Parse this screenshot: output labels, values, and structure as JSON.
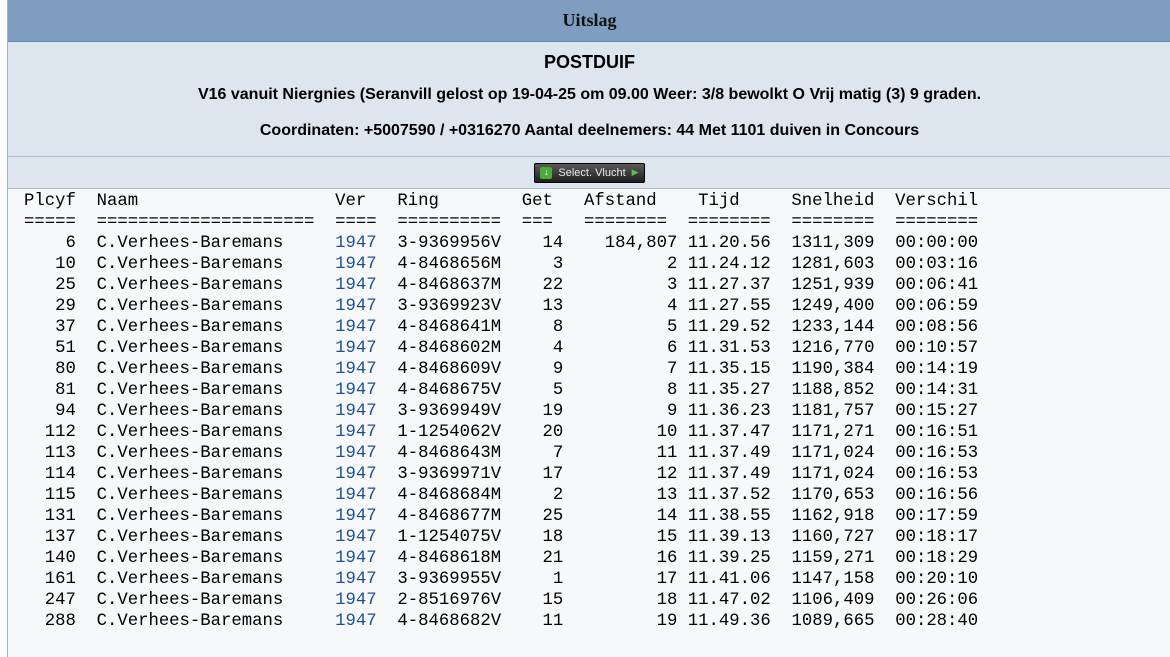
{
  "title": "Uitslag",
  "header": {
    "race": "POSTDUIF",
    "release": "V16 vanuit Niergnies (Seranvill gelost op 19-04-25 om 09.00 Weer: 3/8 bewolkt O Vrij matig (3) 9 graden.",
    "info": "Coordinaten: +5007590 / +0316270 Aantal deelnemers: 44 Met 1101 duiven in Concours"
  },
  "button": {
    "label": "Select. Vlucht",
    "icon": "download-icon",
    "arrow_icon": "arrow-right-icon"
  },
  "table": {
    "header_line": "Plcyf  Naam                   Ver   Ring        Get   Afstand    Tijd     Snelheid  Verschil",
    "separator_line": "=====  =====================  ====  ==========  ===   ========  ========  ========  ========",
    "rows": [
      {
        "plcyf": "6",
        "naam": "C.Verhees-Baremans",
        "ver": "1947",
        "ring": "3-9369956V",
        "get": "14",
        "afstand": "184,807",
        "tijd": "11.20.56",
        "snelheid": "1311,309",
        "verschil": "00:00:00"
      },
      {
        "plcyf": "10",
        "naam": "C.Verhees-Baremans",
        "ver": "1947",
        "ring": "4-8468656M",
        "get": "3",
        "afstand": "2",
        "tijd": "11.24.12",
        "snelheid": "1281,603",
        "verschil": "00:03:16"
      },
      {
        "plcyf": "25",
        "naam": "C.Verhees-Baremans",
        "ver": "1947",
        "ring": "4-8468637M",
        "get": "22",
        "afstand": "3",
        "tijd": "11.27.37",
        "snelheid": "1251,939",
        "verschil": "00:06:41"
      },
      {
        "plcyf": "29",
        "naam": "C.Verhees-Baremans",
        "ver": "1947",
        "ring": "3-9369923V",
        "get": "13",
        "afstand": "4",
        "tijd": "11.27.55",
        "snelheid": "1249,400",
        "verschil": "00:06:59"
      },
      {
        "plcyf": "37",
        "naam": "C.Verhees-Baremans",
        "ver": "1947",
        "ring": "4-8468641M",
        "get": "8",
        "afstand": "5",
        "tijd": "11.29.52",
        "snelheid": "1233,144",
        "verschil": "00:08:56"
      },
      {
        "plcyf": "51",
        "naam": "C.Verhees-Baremans",
        "ver": "1947",
        "ring": "4-8468602M",
        "get": "4",
        "afstand": "6",
        "tijd": "11.31.53",
        "snelheid": "1216,770",
        "verschil": "00:10:57"
      },
      {
        "plcyf": "80",
        "naam": "C.Verhees-Baremans",
        "ver": "1947",
        "ring": "4-8468609V",
        "get": "9",
        "afstand": "7",
        "tijd": "11.35.15",
        "snelheid": "1190,384",
        "verschil": "00:14:19"
      },
      {
        "plcyf": "81",
        "naam": "C.Verhees-Baremans",
        "ver": "1947",
        "ring": "4-8468675V",
        "get": "5",
        "afstand": "8",
        "tijd": "11.35.27",
        "snelheid": "1188,852",
        "verschil": "00:14:31"
      },
      {
        "plcyf": "94",
        "naam": "C.Verhees-Baremans",
        "ver": "1947",
        "ring": "3-9369949V",
        "get": "19",
        "afstand": "9",
        "tijd": "11.36.23",
        "snelheid": "1181,757",
        "verschil": "00:15:27"
      },
      {
        "plcyf": "112",
        "naam": "C.Verhees-Baremans",
        "ver": "1947",
        "ring": "1-1254062V",
        "get": "20",
        "afstand": "10",
        "tijd": "11.37.47",
        "snelheid": "1171,271",
        "verschil": "00:16:51"
      },
      {
        "plcyf": "113",
        "naam": "C.Verhees-Baremans",
        "ver": "1947",
        "ring": "4-8468643M",
        "get": "7",
        "afstand": "11",
        "tijd": "11.37.49",
        "snelheid": "1171,024",
        "verschil": "00:16:53"
      },
      {
        "plcyf": "114",
        "naam": "C.Verhees-Baremans",
        "ver": "1947",
        "ring": "3-9369971V",
        "get": "17",
        "afstand": "12",
        "tijd": "11.37.49",
        "snelheid": "1171,024",
        "verschil": "00:16:53"
      },
      {
        "plcyf": "115",
        "naam": "C.Verhees-Baremans",
        "ver": "1947",
        "ring": "4-8468684M",
        "get": "2",
        "afstand": "13",
        "tijd": "11.37.52",
        "snelheid": "1170,653",
        "verschil": "00:16:56"
      },
      {
        "plcyf": "131",
        "naam": "C.Verhees-Baremans",
        "ver": "1947",
        "ring": "4-8468677M",
        "get": "25",
        "afstand": "14",
        "tijd": "11.38.55",
        "snelheid": "1162,918",
        "verschil": "00:17:59"
      },
      {
        "plcyf": "137",
        "naam": "C.Verhees-Baremans",
        "ver": "1947",
        "ring": "1-1254075V",
        "get": "18",
        "afstand": "15",
        "tijd": "11.39.13",
        "snelheid": "1160,727",
        "verschil": "00:18:17"
      },
      {
        "plcyf": "140",
        "naam": "C.Verhees-Baremans",
        "ver": "1947",
        "ring": "4-8468618M",
        "get": "21",
        "afstand": "16",
        "tijd": "11.39.25",
        "snelheid": "1159,271",
        "verschil": "00:18:29"
      },
      {
        "plcyf": "161",
        "naam": "C.Verhees-Baremans",
        "ver": "1947",
        "ring": "3-9369955V",
        "get": "1",
        "afstand": "17",
        "tijd": "11.41.06",
        "snelheid": "1147,158",
        "verschil": "00:20:10"
      },
      {
        "plcyf": "247",
        "naam": "C.Verhees-Baremans",
        "ver": "1947",
        "ring": "2-8516976V",
        "get": "15",
        "afstand": "18",
        "tijd": "11.47.02",
        "snelheid": "1106,409",
        "verschil": "00:26:06"
      },
      {
        "plcyf": "288",
        "naam": "C.Verhees-Baremans",
        "ver": "1947",
        "ring": "4-8468682V",
        "get": "11",
        "afstand": "19",
        "tijd": "11.49.36",
        "snelheid": "1089,665",
        "verschil": "00:28:40"
      }
    ]
  },
  "colors": {
    "titlebar": "#7f9dc0",
    "header_bg": "#dde5ee",
    "link": "#1f4f8f"
  }
}
